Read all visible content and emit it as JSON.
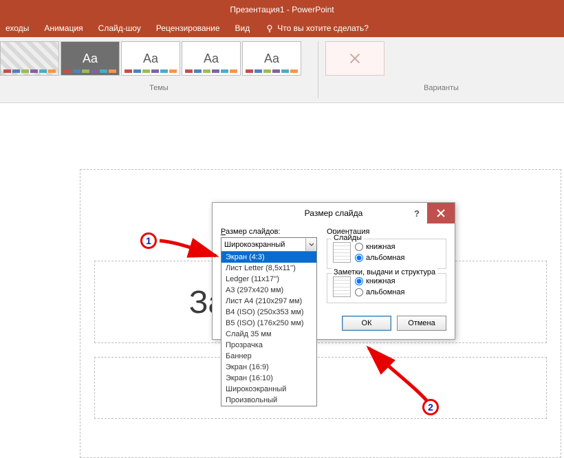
{
  "window": {
    "title": "Презентация1 - PowerPoint"
  },
  "ribbon": {
    "tabs": [
      "еходы",
      "Анимация",
      "Слайд-шоу",
      "Рецензирование",
      "Вид"
    ],
    "tellme": "Что вы хотите сделать?",
    "themes_label": "Темы",
    "variants_label": "Варианты",
    "theme_glyph": "Aa"
  },
  "slide": {
    "title_placeholder": "Заголовок слайда"
  },
  "dialog": {
    "title": "Размер слайда",
    "size_label_pre": "",
    "size_label_u": "Р",
    "size_label_post": "азмер слайдов:",
    "selected": "Широкоэкранный",
    "options": [
      "Экран (4:3)",
      "Лист Letter (8,5x11'')",
      "Ledger (11x17'')",
      "A3 (297x420 мм)",
      "Лист A4 (210x297 мм)",
      "B4 (ISO) (250x353 мм)",
      "B5 (ISO) (176x250 мм)",
      "Слайд 35 мм",
      "Прозрачка",
      "Баннер",
      "Экран (16:9)",
      "Экран (16:10)",
      "Широкоэкранный",
      "Произвольный"
    ],
    "orientation_label": "Ориентация",
    "slides_label": "Слайды",
    "notes_label": "Заметки, выдачи и структура",
    "portrait_u": "к",
    "portrait_post": "нижная",
    "landscape_pre": "а",
    "landscape_u": "л",
    "landscape_post": "ьбомная",
    "notes_portrait_pre": "кн",
    "notes_portrait_u": "и",
    "notes_portrait_post": "жная",
    "notes_landscape_pre": "аль",
    "notes_landscape_u": "б",
    "notes_landscape_post": "омная",
    "ok": "ОК",
    "cancel": "Отмена"
  },
  "annotations": {
    "badge1": "1",
    "badge2": "2"
  }
}
